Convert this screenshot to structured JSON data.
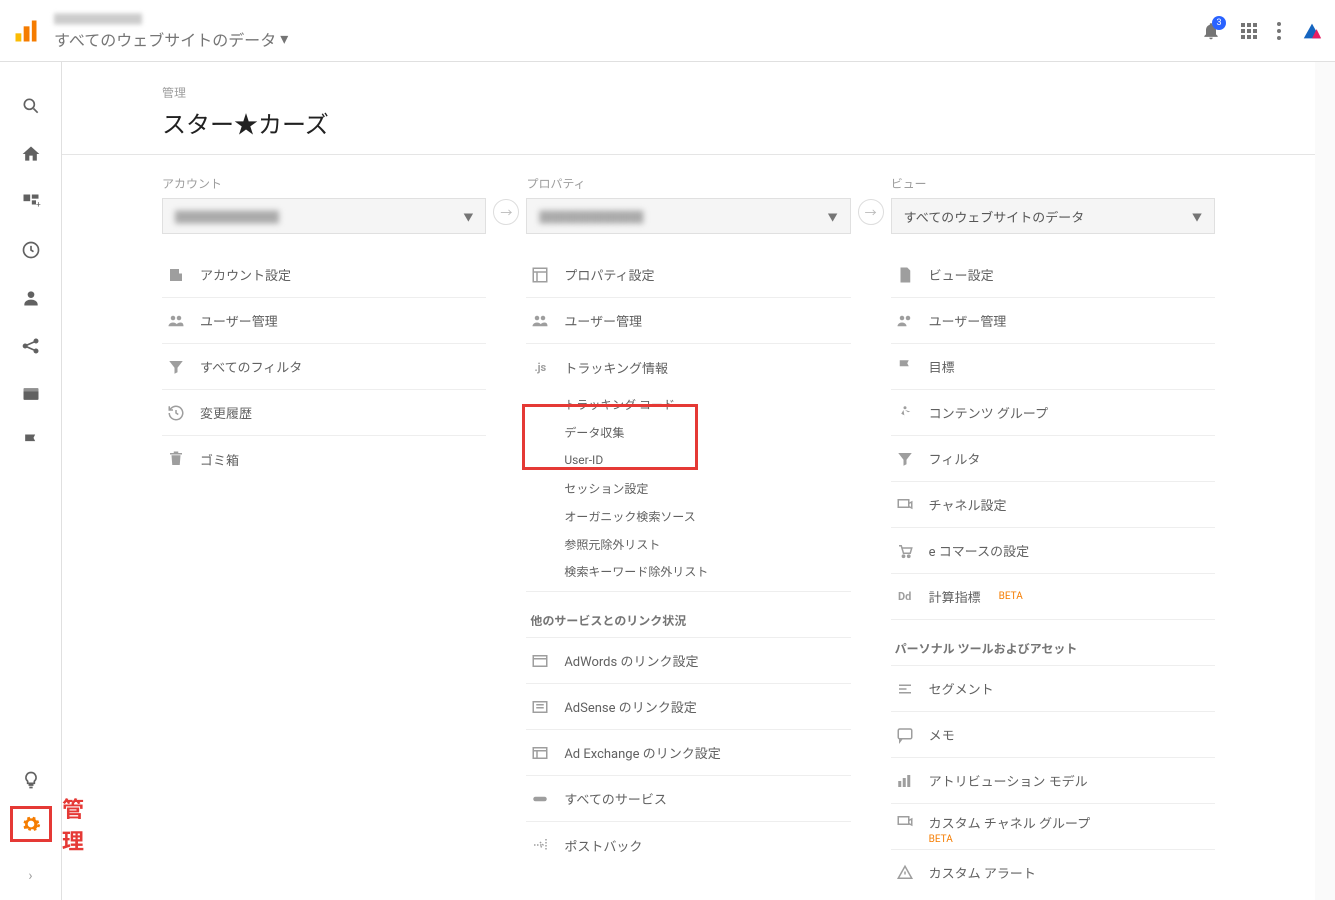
{
  "header": {
    "subtitle": "すべてのウェブサイトのデータ",
    "badge": "3"
  },
  "breadcrumb": "管理",
  "page_title": "スター★カーズ",
  "admin_label": "管理",
  "columns": {
    "account": {
      "label": "アカウント",
      "selected": "████████",
      "items": [
        "アカウント設定",
        "ユーザー管理",
        "すべてのフィルタ",
        "変更履歴",
        "ゴミ箱"
      ]
    },
    "property": {
      "label": "プロパティ",
      "selected": "████████",
      "items_top": [
        "プロパティ設定",
        "ユーザー管理"
      ],
      "tracking_label": "トラッキング情報",
      "tracking_sub": [
        "トラッキング コード",
        "データ収集",
        "User-ID",
        "セッション設定",
        "オーガニック検索ソース",
        "参照元除外リスト",
        "検索キーワード除外リスト"
      ],
      "link_section": "他のサービスとのリンク状況",
      "link_items": [
        "AdWords のリンク設定",
        "AdSense のリンク設定",
        "Ad Exchange のリンク設定",
        "すべてのサービス",
        "ポストバック"
      ]
    },
    "view": {
      "label": "ビュー",
      "selected": "すべてのウェブサイトのデータ",
      "items": [
        {
          "label": "ビュー設定"
        },
        {
          "label": "ユーザー管理"
        },
        {
          "label": "目標"
        },
        {
          "label": "コンテンツ グループ"
        },
        {
          "label": "フィルタ"
        },
        {
          "label": "チャネル設定"
        },
        {
          "label": "e コマースの設定"
        },
        {
          "label": "計算指標",
          "beta": "BETA"
        }
      ],
      "personal_section": "パーソナル ツールおよびアセット",
      "personal_items": [
        {
          "label": "セグメント"
        },
        {
          "label": "メモ"
        },
        {
          "label": "アトリビューション モデル"
        },
        {
          "label": "カスタム チャネル グループ",
          "beta": "BETA"
        },
        {
          "label": "カスタム アラート"
        }
      ]
    }
  }
}
